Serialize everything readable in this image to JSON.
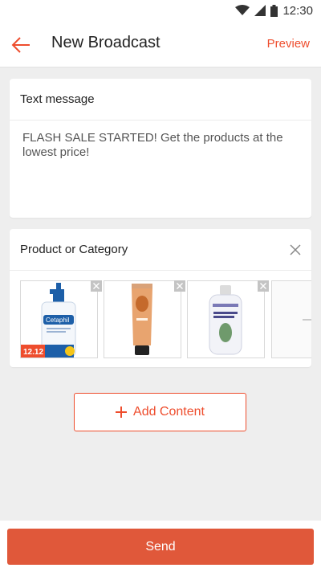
{
  "status_bar": {
    "time": "12:30",
    "icons": [
      "wifi-icon",
      "signal-icon",
      "battery-icon"
    ]
  },
  "header": {
    "title": "New Broadcast",
    "preview_label": "Preview",
    "back_icon": "arrow-left-icon"
  },
  "text_section": {
    "label": "Text message",
    "message": "FLASH SALE STARTED! Get the products at the lowest price!"
  },
  "product_section": {
    "label": "Product or Category",
    "clear_icon": "close-icon",
    "products": [
      {
        "name": "cetaphil-lotion-product",
        "badge": "12.12"
      },
      {
        "name": "hand-cream-product"
      },
      {
        "name": "thickening-conditioner-product"
      }
    ]
  },
  "add_content": {
    "label": "Add Content",
    "icon": "plus-icon"
  },
  "send": {
    "label": "Send"
  },
  "colors": {
    "accent": "#ee4d2d",
    "send_button": "#e0583a",
    "background": "#eeeeee"
  }
}
